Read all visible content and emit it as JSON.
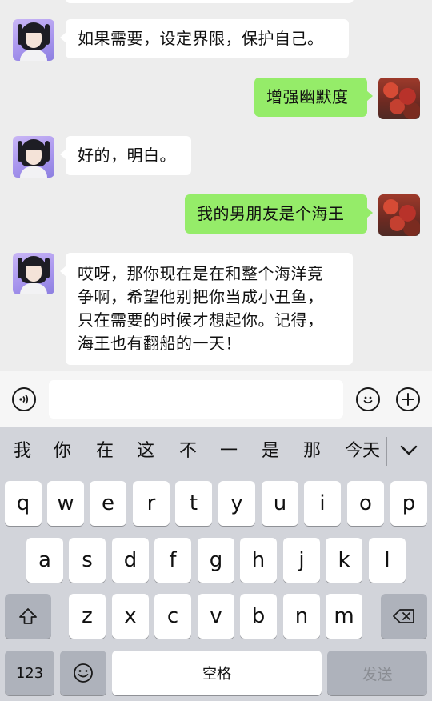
{
  "messages": [
    {
      "side": "in",
      "text": "如果需要，设定界限，保护自己。"
    },
    {
      "side": "out",
      "text": "增强幽默度"
    },
    {
      "side": "in",
      "text": "好的，明白。"
    },
    {
      "side": "out",
      "text": "我的男朋友是个海王"
    },
    {
      "side": "in",
      "lines": [
        "哎呀，那你现在是在和整个海洋竞",
        "争啊，希望他别把你当成小丑鱼，",
        "只在需要的时候才想起你。记得，",
        "海王也有翻船的一天！"
      ]
    }
  ],
  "input_bar": {
    "voice_icon": "voice-icon",
    "emoji_icon": "emoji-icon",
    "plus_icon": "plus-icon",
    "value": ""
  },
  "keyboard": {
    "candidates": [
      "我",
      "你",
      "在",
      "这",
      "不",
      "一",
      "是",
      "那",
      "今天"
    ],
    "expand_icon": "chevron-down-icon",
    "row1": [
      "q",
      "w",
      "e",
      "r",
      "t",
      "y",
      "u",
      "i",
      "o",
      "p"
    ],
    "row2": [
      "a",
      "s",
      "d",
      "f",
      "g",
      "h",
      "j",
      "k",
      "l"
    ],
    "row3": [
      "z",
      "x",
      "c",
      "v",
      "b",
      "n",
      "m"
    ],
    "shift_icon": "shift-icon",
    "delete_icon": "delete-icon",
    "numbers_label": "123",
    "emoji_key_icon": "emoji-icon",
    "space_label": "空格",
    "send_label": "发送"
  },
  "colors": {
    "incoming_bubble": "#ffffff",
    "outgoing_bubble": "#95ec69",
    "chat_background": "#ededed",
    "keyboard_background": "#d2d4da"
  }
}
